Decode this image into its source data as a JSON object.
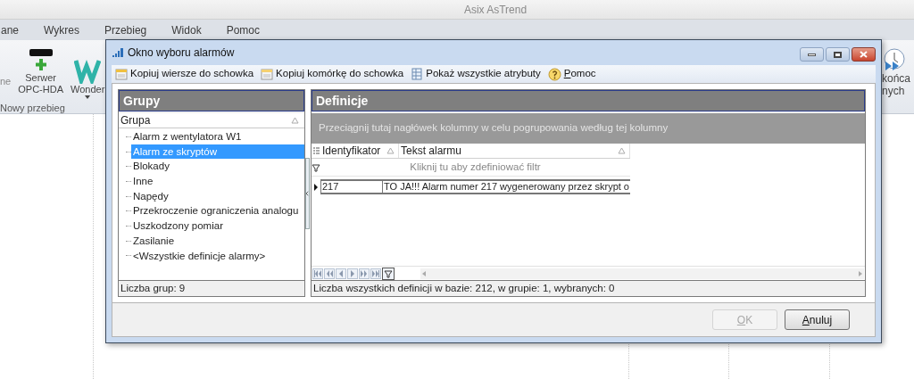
{
  "app": {
    "title": "Asix AsTrend",
    "menu": [
      {
        "label": "ane"
      },
      {
        "label": "Wykres"
      },
      {
        "label": "Przebieg"
      },
      {
        "label": "Widok"
      },
      {
        "label": "Pomoc"
      }
    ],
    "ribbon": {
      "cut_label": "ne",
      "buttons": [
        {
          "kind": "opc",
          "lines": [
            "Serwer",
            "OPC-HDA"
          ],
          "dropdown": false
        },
        {
          "kind": "wonder",
          "lines": [
            "Wonder"
          ],
          "dropdown": true
        }
      ],
      "group_label": "Nowy przebieg",
      "right_button": {
        "lines": [
          "końca",
          "nych"
        ]
      }
    }
  },
  "dialog": {
    "title": "Okno wyboru alarmów",
    "toolbar": [
      {
        "kind": "copy-rows",
        "label": "Kopiuj wiersze do schowka",
        "mnemonic": false
      },
      {
        "kind": "copy-cell",
        "label": "Kopiuj komórkę do schowka",
        "mnemonic": false
      },
      {
        "kind": "attributes",
        "label": "Pokaż wszystkie atrybuty",
        "mnemonic": false
      },
      {
        "kind": "help",
        "label": "Pomoc",
        "mnemonic": true
      }
    ],
    "groups": {
      "header": "Grupy",
      "column": "Grupa",
      "items": [
        {
          "label": "Alarm z wentylatora W1",
          "selected": false
        },
        {
          "label": "Alarm ze skryptów",
          "selected": true
        },
        {
          "label": "Blokady",
          "selected": false
        },
        {
          "label": "Inne",
          "selected": false
        },
        {
          "label": "Napędy",
          "selected": false
        },
        {
          "label": "Przekroczenie ograniczenia analogu",
          "selected": false
        },
        {
          "label": "Uszkodzony pomiar",
          "selected": false
        },
        {
          "label": "Zasilanie",
          "selected": false
        },
        {
          "label": "<Wszystkie definicje alarmy>",
          "selected": false
        }
      ],
      "footer": "Liczba grup: 9"
    },
    "definitions": {
      "header": "Definicje",
      "group_hint": "Przeciągnij tutaj nagłówek kolumny w celu pogrupowania według tej kolumny",
      "columns": [
        {
          "label": "Identyfikator",
          "sortable": true
        },
        {
          "label": "Tekst alarmu",
          "sortable": true
        }
      ],
      "filter_hint": "Kliknij tu aby zdefiniować filtr",
      "rows": [
        {
          "cells": [
            "217",
            "TO JA!!! Alarm numer 217 wygenerowany przez skrypt  o"
          ],
          "current": true
        }
      ],
      "footer": "Liczba wszystkich definicji w bazie: 212, w grupie: 1, wybranych: 0"
    },
    "buttons": [
      {
        "label": "OK",
        "disabled": true,
        "mnemonic": true
      },
      {
        "label": "Anuluj",
        "disabled": false,
        "mnemonic": true
      }
    ]
  }
}
